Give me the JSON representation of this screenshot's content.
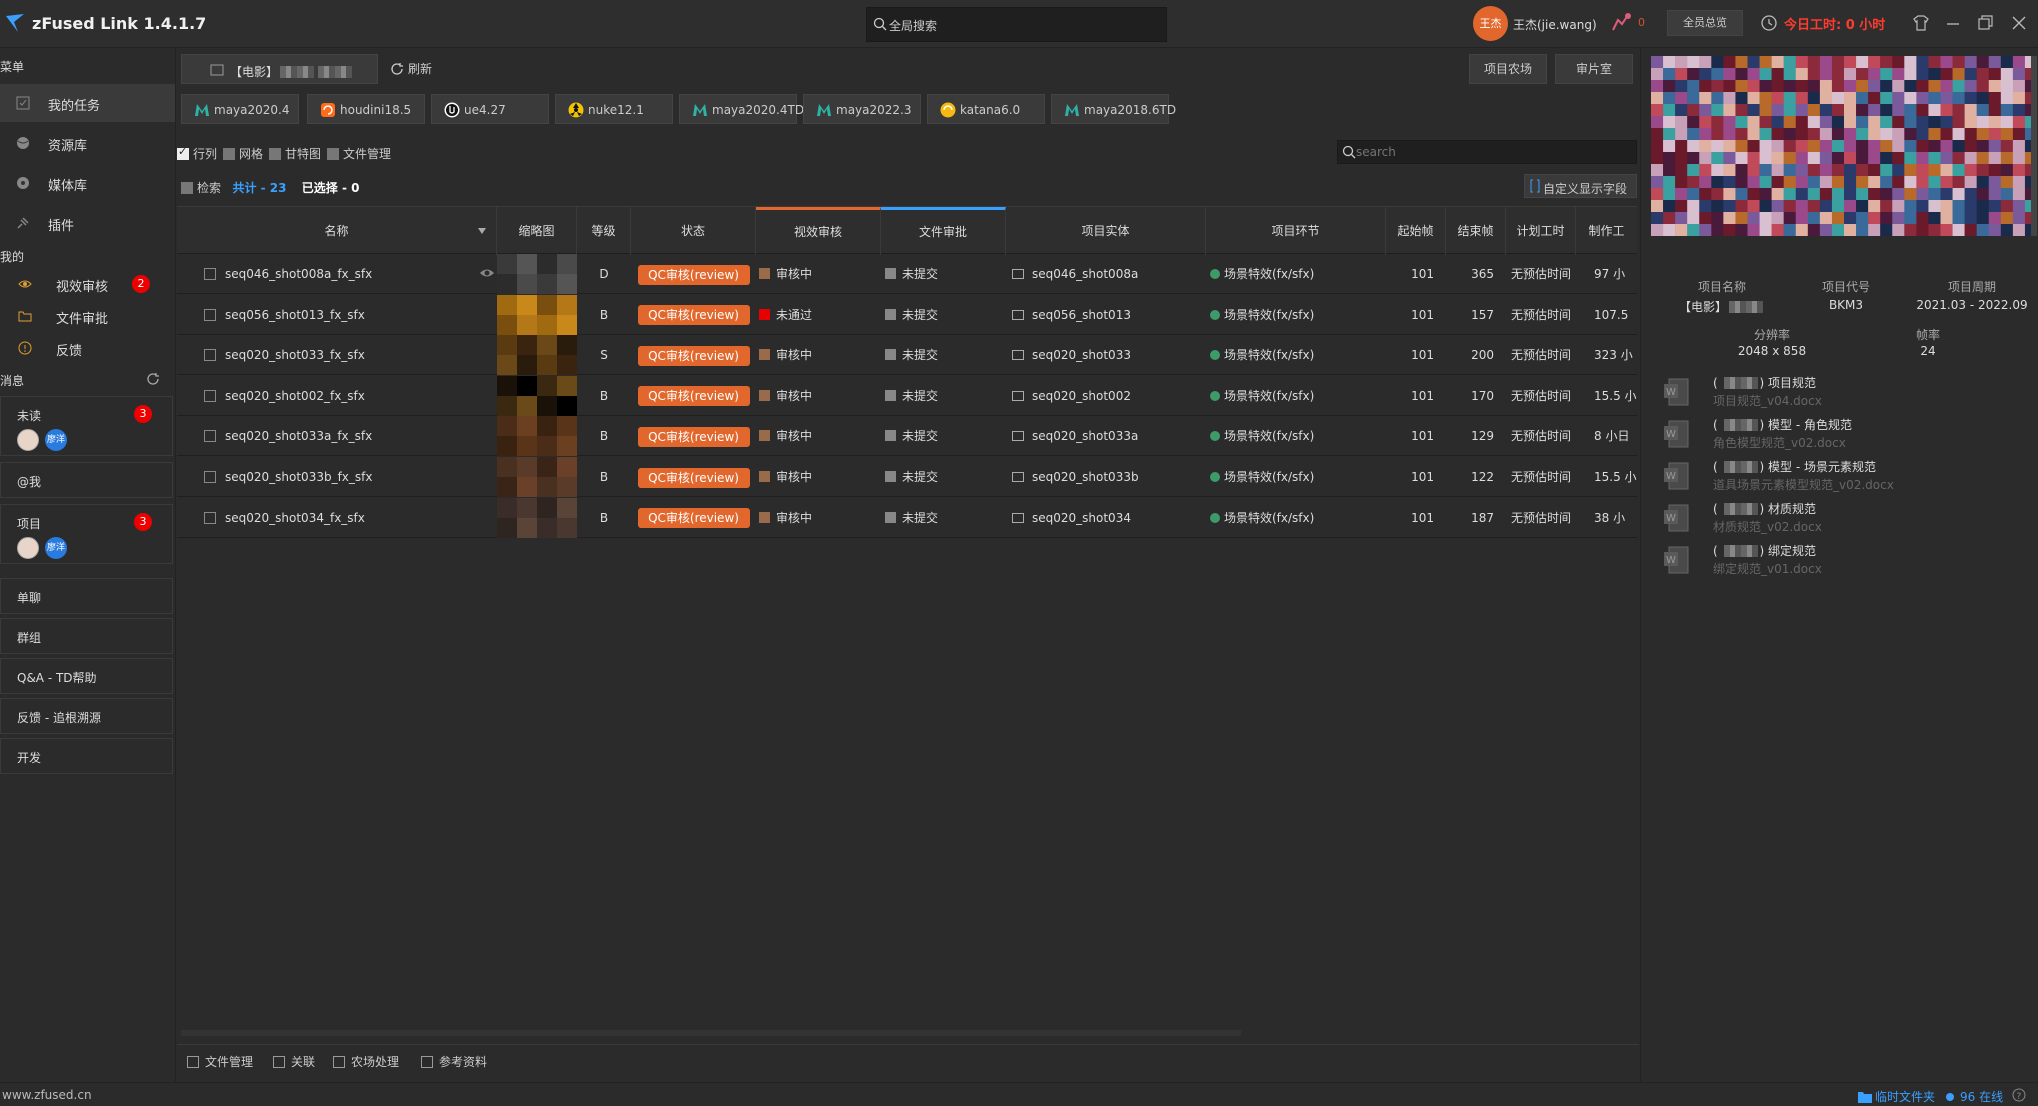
{
  "app": {
    "title": "zFused Link 1.4.1.7"
  },
  "titlebar": {
    "search_placeholder": "全局搜索",
    "user_avatar": "王杰",
    "user_name": "王杰(jie.wang)",
    "notif_count": "0",
    "overview_btn": "全员总览",
    "today_hours": "今日工时: 0 小时"
  },
  "sidebar": {
    "menu_title": "菜单",
    "items": [
      {
        "label": "我的任务",
        "icon": "task-icon"
      },
      {
        "label": "资源库",
        "icon": "globe-icon"
      },
      {
        "label": "媒体库",
        "icon": "media-icon"
      },
      {
        "label": "插件",
        "icon": "plugin-icon"
      }
    ],
    "my_title": "我的",
    "my_items": [
      {
        "label": "视效审核",
        "icon": "eye-icon",
        "badge": "2"
      },
      {
        "label": "文件审批",
        "icon": "folder-icon"
      },
      {
        "label": "反馈",
        "icon": "info-icon"
      }
    ],
    "msg_title": "消息",
    "messages": [
      {
        "label": "未读",
        "badge": "3",
        "avatar2": "廖洋"
      },
      {
        "label": "@我"
      },
      {
        "label": "项目",
        "badge": "3",
        "avatar2": "廖洋"
      },
      {
        "label": "单聊"
      },
      {
        "label": "群组"
      },
      {
        "label": "Q&A - TD帮助"
      },
      {
        "label": "反馈 - 追根溯源"
      },
      {
        "label": "开发"
      }
    ]
  },
  "main": {
    "project_tab": "【电影】",
    "refresh": "刷新",
    "farm_btn": "项目农场",
    "review_btn": "审片室",
    "apps": [
      "maya2020.4",
      "houdini18.5",
      "ue4.27",
      "nuke12.1",
      "maya2020.4TD",
      "maya2022.3",
      "katana6.0",
      "maya2018.6TD"
    ],
    "view_options": [
      "行列",
      "网格",
      "甘特图",
      "文件管理"
    ],
    "search_placeholder": "search",
    "filter_label": "检索",
    "count_total": "共计 - 23",
    "count_selected": "已选择 - 0",
    "custom_fields_btn": "自定义显示字段",
    "columns": [
      "名称",
      "缩略图",
      "等级",
      "状态",
      "视效审核",
      "文件审批",
      "项目实体",
      "项目环节",
      "起始帧",
      "结束帧",
      "计划工时",
      "制作工"
    ],
    "rows": [
      {
        "name": "seq046_shot008a_fx_sfx",
        "grade": "D",
        "status": "QC审核(review)",
        "vis": "审核中",
        "file": "未提交",
        "entity": "seq046_shot008a",
        "step": "场景特效(fx/sfx)",
        "start": "101",
        "end": "365",
        "plan": "无预估时间",
        "work": "97 小"
      },
      {
        "name": "seq056_shot013_fx_sfx",
        "grade": "B",
        "status": "QC审核(review)",
        "vis": "未通过",
        "file": "未提交",
        "entity": "seq056_shot013",
        "step": "场景特效(fx/sfx)",
        "start": "101",
        "end": "157",
        "plan": "无预估时间",
        "work": "107.5"
      },
      {
        "name": "seq020_shot033_fx_sfx",
        "grade": "S",
        "status": "QC审核(review)",
        "vis": "审核中",
        "file": "未提交",
        "entity": "seq020_shot033",
        "step": "场景特效(fx/sfx)",
        "start": "101",
        "end": "200",
        "plan": "无预估时间",
        "work": "323 小"
      },
      {
        "name": "seq020_shot002_fx_sfx",
        "grade": "B",
        "status": "QC审核(review)",
        "vis": "审核中",
        "file": "未提交",
        "entity": "seq020_shot002",
        "step": "场景特效(fx/sfx)",
        "start": "101",
        "end": "170",
        "plan": "无预估时间",
        "work": "15.5 小"
      },
      {
        "name": "seq020_shot033a_fx_sfx",
        "grade": "B",
        "status": "QC审核(review)",
        "vis": "审核中",
        "file": "未提交",
        "entity": "seq020_shot033a",
        "step": "场景特效(fx/sfx)",
        "start": "101",
        "end": "129",
        "plan": "无预估时间",
        "work": "8 小日"
      },
      {
        "name": "seq020_shot033b_fx_sfx",
        "grade": "B",
        "status": "QC审核(review)",
        "vis": "审核中",
        "file": "未提交",
        "entity": "seq020_shot033b",
        "step": "场景特效(fx/sfx)",
        "start": "101",
        "end": "122",
        "plan": "无预估时间",
        "work": "15.5 小"
      },
      {
        "name": "seq020_shot034_fx_sfx",
        "grade": "B",
        "status": "QC审核(review)",
        "vis": "审核中",
        "file": "未提交",
        "entity": "seq020_shot034",
        "step": "场景特效(fx/sfx)",
        "start": "101",
        "end": "187",
        "plan": "无预估时间",
        "work": "38 小"
      }
    ],
    "bottom": [
      "文件管理",
      "关联",
      "农场处理",
      "参考资料"
    ]
  },
  "right_panel": {
    "project_name_label": "项目名称",
    "project_name": "【电影】",
    "project_code_label": "项目代号",
    "project_code": "BKM3",
    "project_period_label": "项目周期",
    "project_period": "2021.03 - 2022.09",
    "resolution_label": "分辨率",
    "resolution": "2048 x 858",
    "fps_label": "帧率",
    "fps": "24",
    "docs": [
      {
        "title": "项目规范",
        "file": "项目规范_v04.docx"
      },
      {
        "title": "模型 - 角色规范",
        "file": "角色模型规范_v02.docx"
      },
      {
        "title": "模型 - 场景元素规范",
        "file": "道具场景元素模型规范_v02.docx"
      },
      {
        "title": "材质规范",
        "file": "材质规范_v02.docx"
      },
      {
        "title": "绑定规范",
        "file": "绑定规范_v01.docx"
      }
    ]
  },
  "statusbar": {
    "website": "www.zfused.cn",
    "tmp_folder": "临时文件夹",
    "online": "96 在线"
  }
}
